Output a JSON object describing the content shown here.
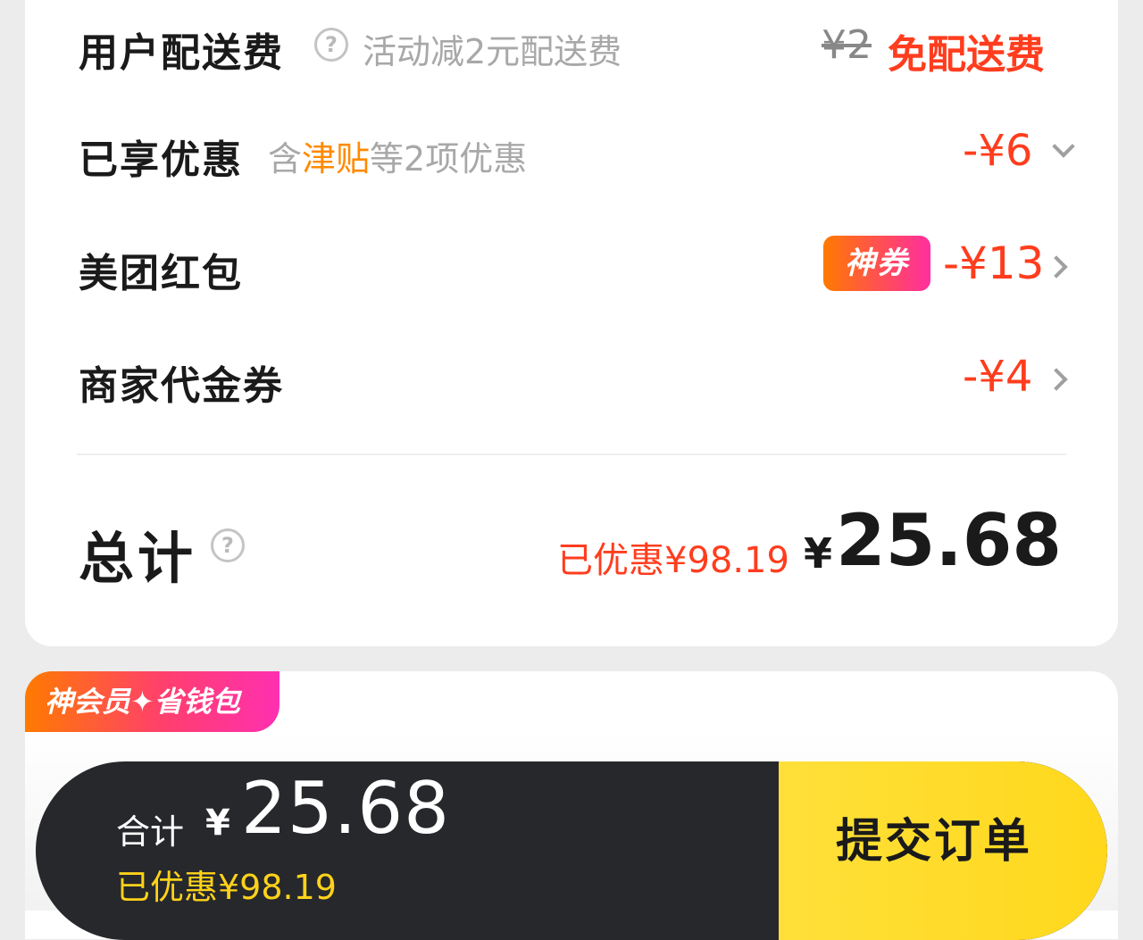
{
  "fees": {
    "delivery": {
      "label": "用户配送费",
      "note": "活动减2元配送费",
      "original_price": "¥2",
      "final_label": "免配送费"
    },
    "discounts": {
      "label": "已享优惠",
      "note_prefix": "含",
      "note_highlight": "津贴",
      "note_suffix": "等2项优惠",
      "value": "-¥6"
    },
    "red_packet": {
      "label": "美团红包",
      "badge": "神券",
      "value": "-¥13"
    },
    "merchant_voucher": {
      "label": "商家代金券",
      "value": "-¥4"
    }
  },
  "total": {
    "label": "总计",
    "saved_text": "已优惠¥98.19",
    "currency": "¥",
    "amount": "25.68"
  },
  "member_banner": {
    "text": "神会员✦省钱包"
  },
  "checkout": {
    "label": "合计",
    "currency": "¥",
    "amount": "25.68",
    "saved_text": "已优惠¥98.19",
    "submit_label": "提交订单"
  },
  "colors": {
    "accent_red": "#ff3d1e",
    "accent_orange": "#ff8a00",
    "submit_yellow": "#ffd81c",
    "bar_dark": "#26282c"
  },
  "icons": [
    "help-circle-icon",
    "chevron-down-icon",
    "chevron-right-icon"
  ]
}
